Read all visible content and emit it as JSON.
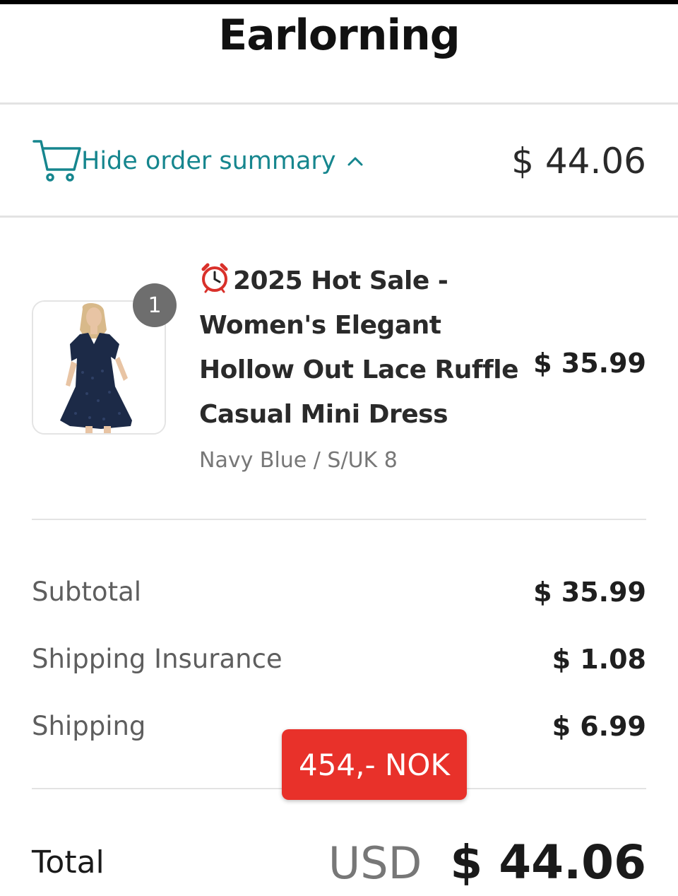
{
  "brand": "Earlorning",
  "summary": {
    "toggle_label": "Hide order summary",
    "total": "$ 44.06",
    "icons": {
      "cart": "cart-icon",
      "chevron": "chevron-up-icon"
    },
    "accent_color": "#16868e"
  },
  "item": {
    "quantity": "1",
    "title_icon": "alarm-clock-icon",
    "title_lines": [
      "2025 Hot Sale -",
      "Women's Elegant",
      "Hollow Out Lace Ruffle",
      "Casual Mini Dress"
    ],
    "variant": "Navy Blue / S/UK 8",
    "price": "$ 35.99",
    "image": "navy-blue-lace-mini-dress-photo"
  },
  "costs": [
    {
      "label": "Subtotal",
      "value": "$ 35.99"
    },
    {
      "label": "Shipping Insurance",
      "value": "$ 1.08"
    },
    {
      "label": "Shipping",
      "value": "$ 6.99"
    }
  ],
  "sticker": {
    "text": "454,- NOK",
    "color": "#e8312a"
  },
  "total": {
    "label": "Total",
    "currency": "USD",
    "amount": "$ 44.06"
  }
}
